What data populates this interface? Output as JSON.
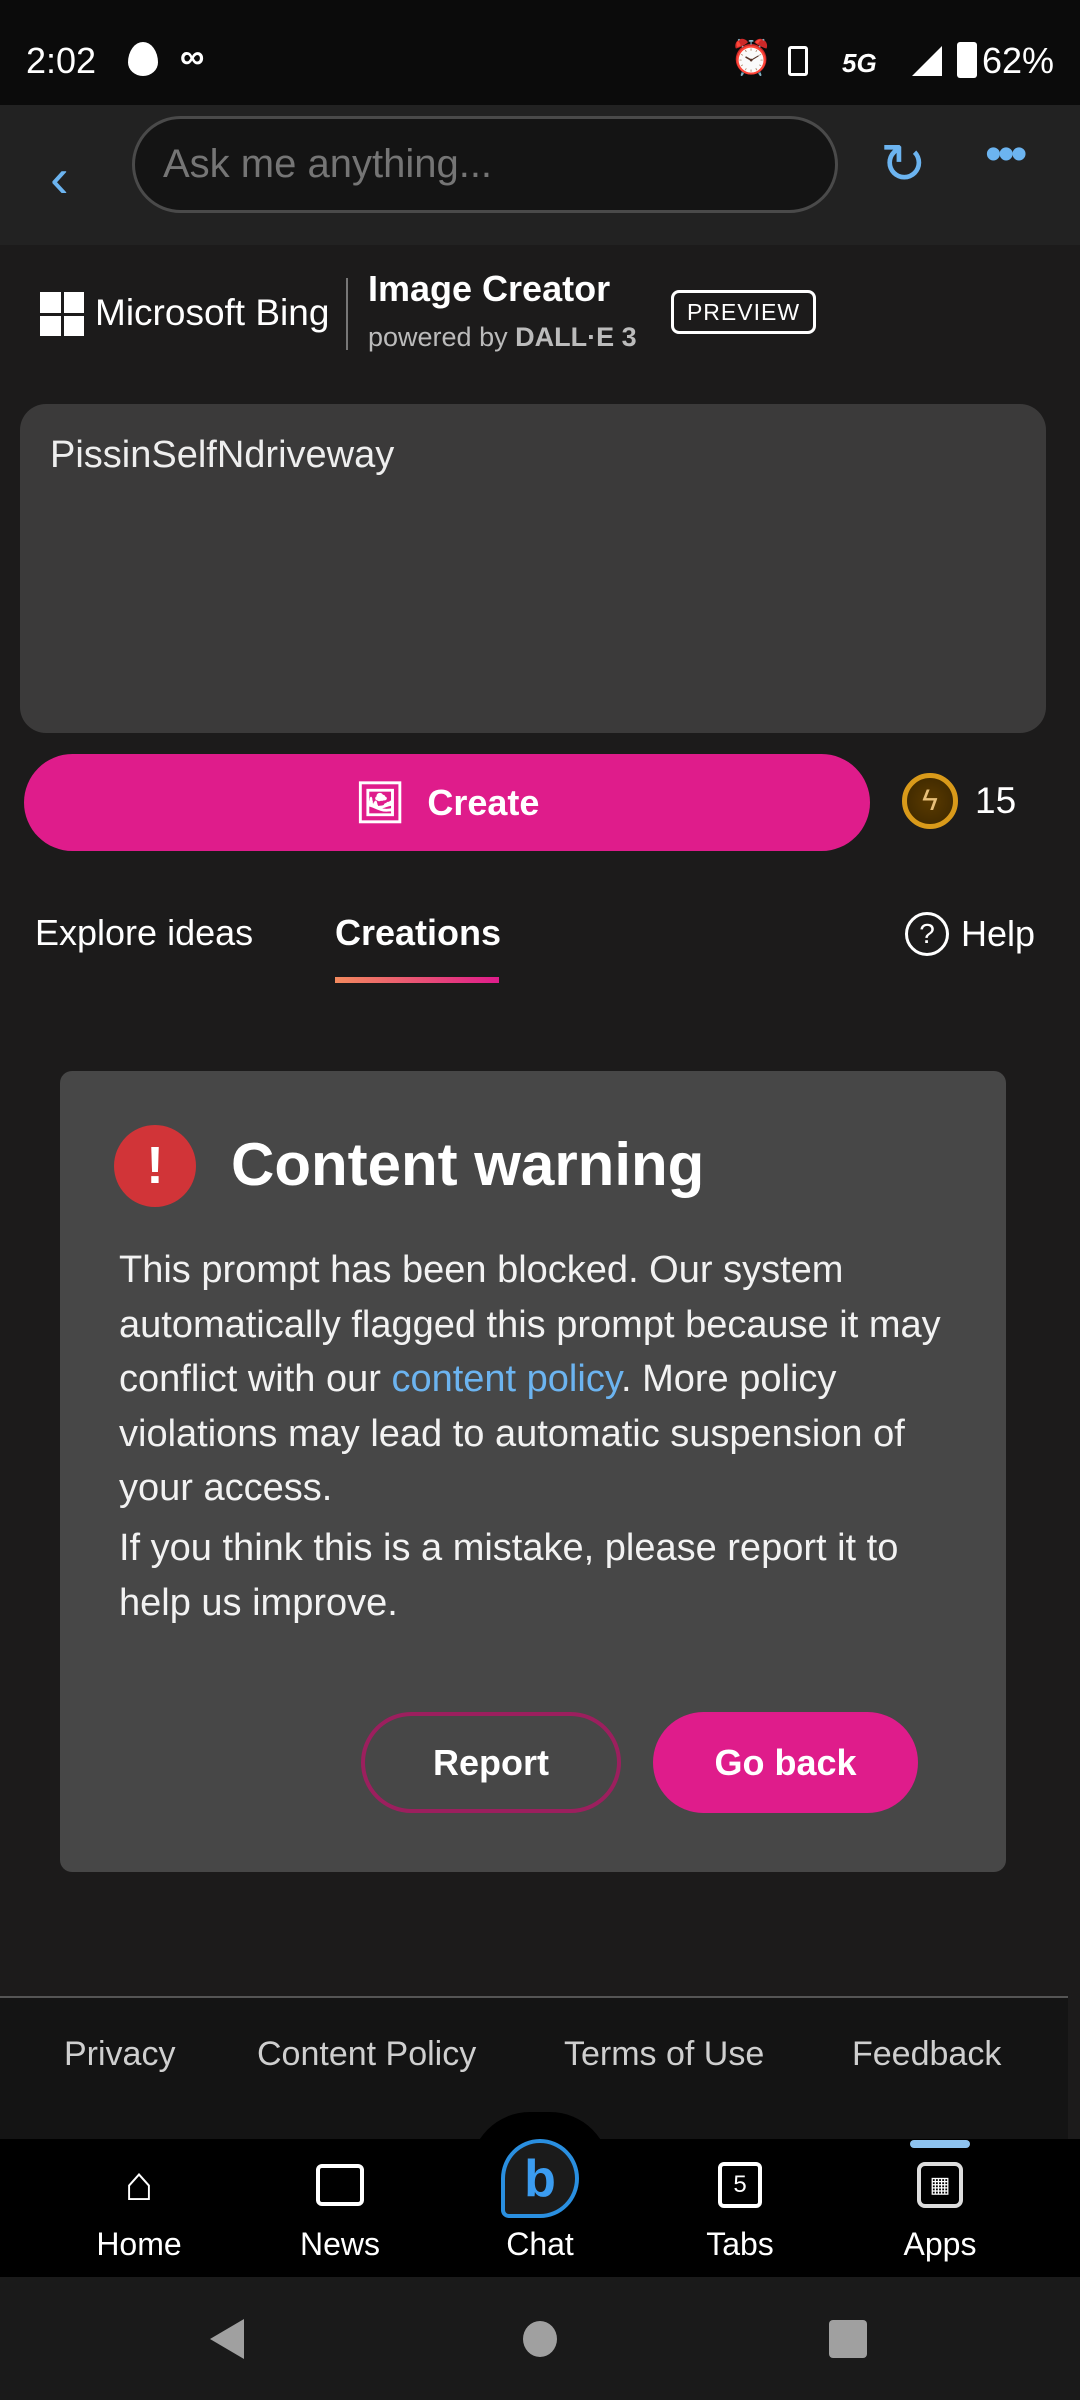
{
  "status": {
    "time": "2:02",
    "network": "5G",
    "battery": "62%"
  },
  "toolbar": {
    "search_placeholder": "Ask me anything..."
  },
  "header": {
    "brand": "Microsoft Bing",
    "product": "Image Creator",
    "powered_prefix": "powered by ",
    "powered_model": "DALL·E 3",
    "badge": "PREVIEW"
  },
  "prompt": {
    "value": "PissinSelfNdriveway"
  },
  "create": {
    "label": "Create",
    "boosts": "15"
  },
  "tabs": [
    {
      "label": "Explore ideas",
      "active": false
    },
    {
      "label": "Creations",
      "active": true
    }
  ],
  "help": "Help",
  "warning": {
    "title": "Content warning",
    "p1_before": "This prompt has been blocked. Our system automatically flagged this prompt because it may conflict with our ",
    "p1_link": "content policy",
    "p1_after": ". More policy violations may lead to automatic suspension of your access.",
    "p2": "If you think this is a mistake, please report it to help us improve.",
    "report": "Report",
    "go_back": "Go back"
  },
  "footer": {
    "links": [
      "Privacy",
      "Content Policy",
      "Terms of Use",
      "Feedback"
    ]
  },
  "bottom_nav": [
    {
      "label": "Home"
    },
    {
      "label": "News"
    },
    {
      "label": "Chat"
    },
    {
      "label": "Tabs",
      "count": "5"
    },
    {
      "label": "Apps"
    }
  ],
  "colors": {
    "accent": "#df1c8b",
    "link": "#6cb4f0",
    "error": "#d13438"
  }
}
